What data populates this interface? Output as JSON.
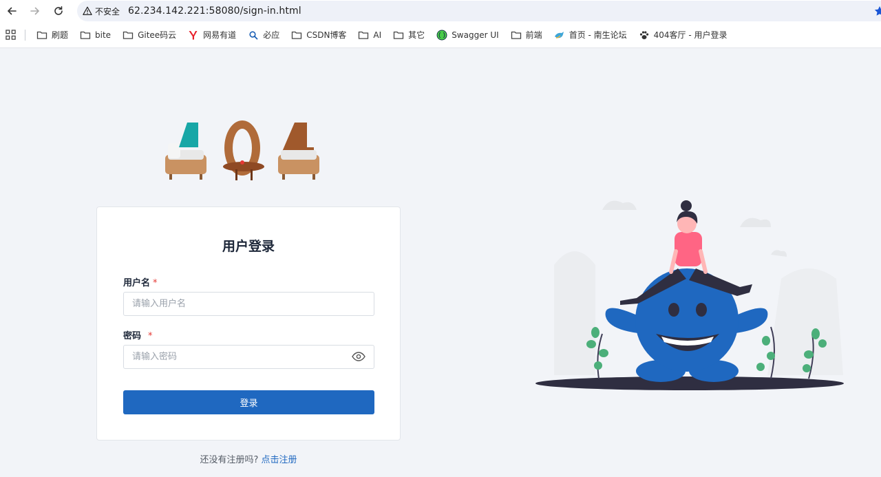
{
  "browser": {
    "security_label": "不安全",
    "url": "62.234.142.221:58080/sign-in.html",
    "bookmarks": [
      {
        "label": "刷题",
        "icon": "folder-icon"
      },
      {
        "label": "bite",
        "icon": "folder-icon"
      },
      {
        "label": "Gitee码云",
        "icon": "folder-icon"
      },
      {
        "label": "网易有道",
        "icon": "youdao-icon"
      },
      {
        "label": "必应",
        "icon": "bing-icon"
      },
      {
        "label": "CSDN博客",
        "icon": "folder-icon"
      },
      {
        "label": "AI",
        "icon": "folder-icon"
      },
      {
        "label": "其它",
        "icon": "folder-icon"
      },
      {
        "label": "Swagger UI",
        "icon": "swagger-icon"
      },
      {
        "label": "前端",
        "icon": "folder-icon"
      },
      {
        "label": "首页 - 南生论坛",
        "icon": "bird-icon"
      },
      {
        "label": "404客厅 - 用户登录",
        "icon": "paw-icon"
      }
    ]
  },
  "login": {
    "title": "用户登录",
    "username_label": "用户名",
    "username_placeholder": "请输入用户名",
    "password_label": "密码",
    "password_placeholder": "请输入密码",
    "required_mark": "*",
    "submit_label": "登录",
    "register_prompt": "还没有注册吗?",
    "register_link": "点击注册"
  },
  "logo_text": "404",
  "colors": {
    "primary": "#1f68c0",
    "background": "#f2f4f8",
    "required": "#e53935"
  }
}
